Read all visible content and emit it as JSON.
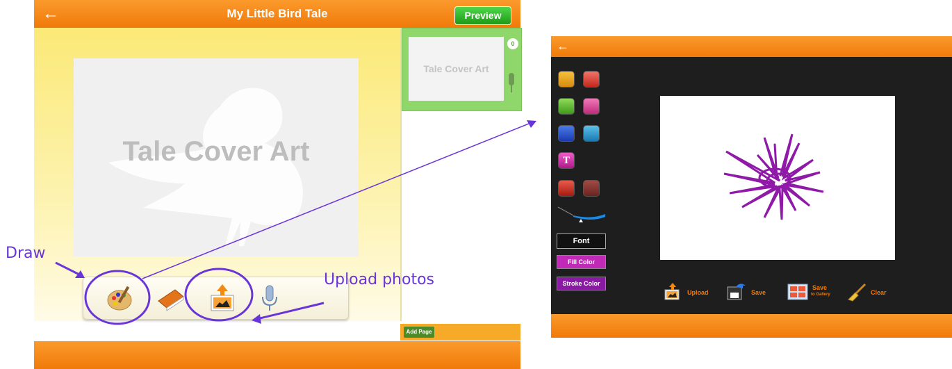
{
  "left_app": {
    "title": "My Little Bird Tale",
    "preview_label": "Preview",
    "cover_text": "Tale Cover Art",
    "thumbnail_text": "Tale Cover Art",
    "thumbnail_count": "0",
    "add_page_label": "Add Page",
    "tools": [
      "palette-icon",
      "book-icon",
      "upload-photo-icon",
      "microphone-icon"
    ]
  },
  "right_app": {
    "font_label": "Font",
    "fill_color_label": "Fill Color",
    "stroke_color_label": "Stroke Color",
    "upload_label": "Upload",
    "save_label": "Save",
    "save_gallery_label": "Save",
    "save_gallery_sub": "to Gallery",
    "clear_label": "Clear",
    "stroke_color": "#8f1aa8"
  },
  "annotations": {
    "draw_label": "Draw",
    "upload_label": "Upload photos",
    "color": "#6a35d8"
  }
}
